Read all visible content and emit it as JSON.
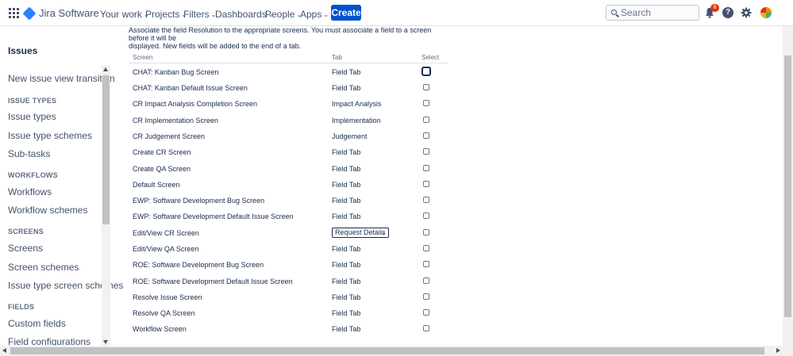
{
  "topnav": {
    "product": "Jira Software",
    "items": [
      {
        "label": "Your work"
      },
      {
        "label": "Projects"
      },
      {
        "label": "Filters"
      },
      {
        "label": "Dashboards"
      },
      {
        "label": "People"
      },
      {
        "label": "Apps"
      }
    ],
    "create_label": "Create",
    "search_placeholder": "Search",
    "notification_count": "8",
    "help_glyph": "?",
    "accent_color": "#0052cc"
  },
  "sidebar": {
    "title": "Issues",
    "link_new_issue_view": "New issue view transition",
    "section_issue_types": "ISSUE TYPES",
    "link_issue_types": "Issue types",
    "link_issue_type_schemes": "Issue type schemes",
    "link_sub_tasks": "Sub-tasks",
    "section_workflows": "WORKFLOWS",
    "link_workflows": "Workflows",
    "link_workflow_schemes": "Workflow schemes",
    "section_screens": "SCREENS",
    "link_screens": "Screens",
    "link_screen_schemes": "Screen schemes",
    "link_issue_type_screen_schemes": "Issue type screen schemes",
    "section_fields": "FIELDS",
    "link_custom_fields": "Custom fields",
    "link_field_configurations": "Field configurations"
  },
  "main": {
    "intro_line1": "Associate the field Resolution to the appropriate screens. You must associate a field to a screen before it will be",
    "intro_line2": "displayed. New fields will be added to the end of a tab.",
    "columns": {
      "screen": "Screen",
      "tab": "Tab",
      "select": "Select"
    },
    "rows": [
      {
        "screen": "CHAT: Kanban Bug Screen",
        "tab": "Field Tab"
      },
      {
        "screen": "CHAT: Kanban Default Issue Screen",
        "tab": "Field Tab"
      },
      {
        "screen": "CR Impact Analysis Completion Screen",
        "tab": "Impact Analysis"
      },
      {
        "screen": "CR Implementation Screen",
        "tab": "Implementation"
      },
      {
        "screen": "CR Judgement Screen",
        "tab": "Judgement"
      },
      {
        "screen": "Create CR Screen",
        "tab": "Field Tab"
      },
      {
        "screen": "Create QA Screen",
        "tab": "Field Tab"
      },
      {
        "screen": "Default Screen",
        "tab": "Field Tab"
      },
      {
        "screen": "EWP: Software Development Bug Screen",
        "tab": "Field Tab"
      },
      {
        "screen": "EWP: Software Development Default Issue Screen",
        "tab": "Field Tab"
      },
      {
        "screen": "Edit/View CR Screen",
        "tab": "Request Details"
      },
      {
        "screen": "Edit/View QA Screen",
        "tab": "Field Tab"
      },
      {
        "screen": "ROE: Software Development Bug Screen",
        "tab": "Field Tab"
      },
      {
        "screen": "ROE: Software Development Default Issue Screen",
        "tab": "Field Tab"
      },
      {
        "screen": "Resolve Issue Screen",
        "tab": "Field Tab"
      },
      {
        "screen": "Resolve QA Screen",
        "tab": "Field Tab"
      },
      {
        "screen": "Workflow Screen",
        "tab": "Field Tab"
      }
    ]
  }
}
